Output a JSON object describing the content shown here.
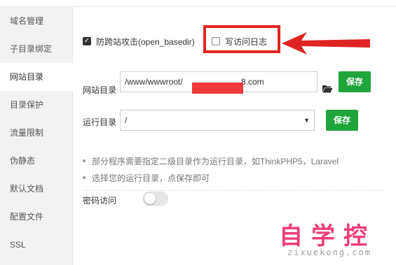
{
  "sidebar": {
    "items": [
      {
        "label": "域名管理"
      },
      {
        "label": "子目录绑定"
      },
      {
        "label": "网站目录",
        "active": true
      },
      {
        "label": "目录保护"
      },
      {
        "label": "流量限制"
      },
      {
        "label": "伪静态"
      },
      {
        "label": "默认文档"
      },
      {
        "label": "配置文件"
      },
      {
        "label": "SSL"
      }
    ]
  },
  "main": {
    "anti_xss": {
      "label": "防跨站攻击(open_basedir)",
      "checked": true
    },
    "access_log": {
      "label": "写访问日志",
      "checked": false
    },
    "site_dir": {
      "label": "网站目录",
      "prefix": "/www/wwwroot/",
      "suffix": "8.com",
      "save_label": "保存"
    },
    "run_dir": {
      "label": "运行目录",
      "value": "/",
      "save_label": "保存"
    },
    "tips": [
      "部分程序需要指定二级目录作为运行目录，如ThinkPHP5，Laravel",
      "选择您的运行目录，点保存即可"
    ],
    "password_access": {
      "label": "密码访问",
      "enabled": false
    }
  },
  "icons": {
    "check": "checkmark-icon",
    "folder": "folder-open-icon",
    "caret": "caret-down-icon",
    "annotation": "red-arrow-icon"
  },
  "colors": {
    "accent_green": "#20a53a",
    "annotation_red": "#e02424",
    "redaction_red": "#f03a3a",
    "watermark_pink": "#ee2a6c"
  },
  "watermark": {
    "text_cn": "自学控",
    "text_en": "zixuekong.com"
  }
}
